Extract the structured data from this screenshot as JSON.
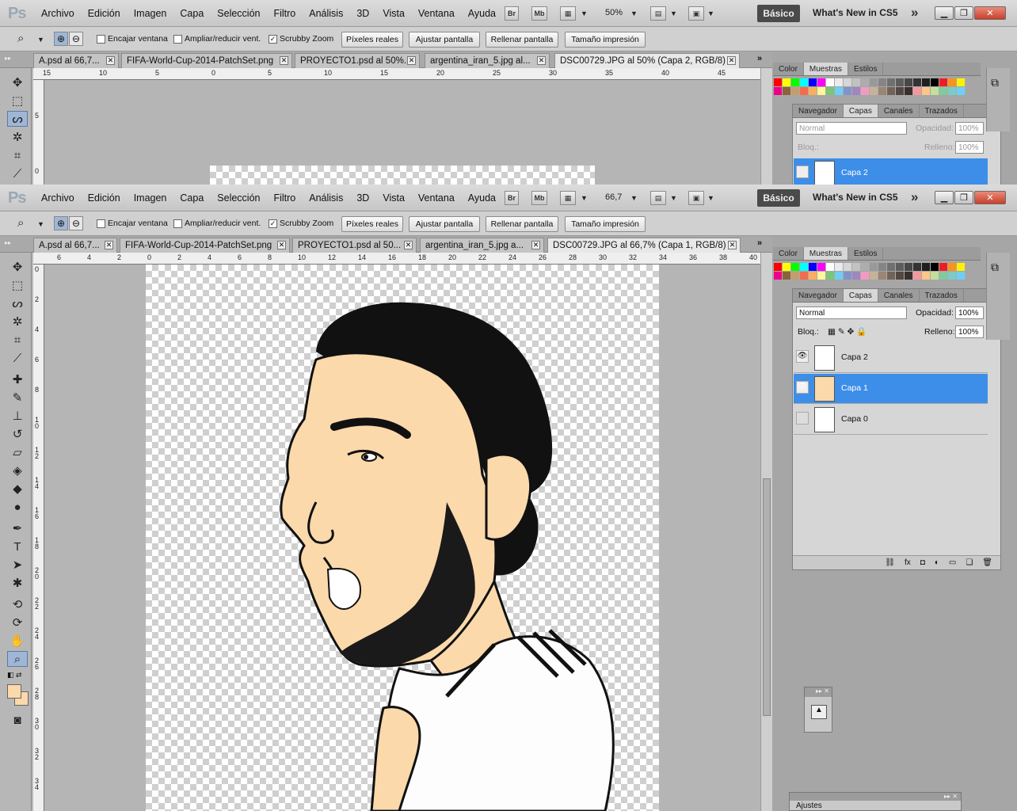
{
  "app": {
    "logo": "Ps"
  },
  "menu": [
    "Archivo",
    "Edición",
    "Imagen",
    "Capa",
    "Selección",
    "Filtro",
    "Análisis",
    "3D",
    "Vista",
    "Ventana",
    "Ayuda"
  ],
  "appbar": {
    "br": "Br",
    "mb": "Mb",
    "zoom_top": "50%",
    "zoom_bottom": "66,7",
    "workspace": "Básico",
    "whats_new": "What's New in CS5",
    "more": "»"
  },
  "options": {
    "checks": [
      {
        "label": "Encajar ventana",
        "checked": false
      },
      {
        "label": "Ampliar/reducir vent.",
        "checked": false
      },
      {
        "label": "Scrubby Zoom",
        "checked": true
      }
    ],
    "buttons": [
      "Píxeles reales",
      "Ajustar pantalla",
      "Rellenar pantalla",
      "Tamaño impresión"
    ]
  },
  "tabs_top": [
    "A.psd al 66,7...",
    "FIFA-World-Cup-2014-PatchSet.png",
    "PROYECTO1.psd al 50%...",
    "argentina_iran_5.jpg al...",
    "DSC00729.JPG al 50% (Capa 2, RGB/8) *"
  ],
  "tabs_bottom": [
    "A.psd al 66,7...",
    "FIFA-World-Cup-2014-PatchSet.png",
    "PROYECTO1.psd al 50...",
    "argentina_iran_5.jpg a...",
    "DSC00729.JPG al 66,7% (Capa 1, RGB/8) *"
  ],
  "ruler_top": [
    "15",
    "10",
    "5",
    "0",
    "5",
    "10",
    "15",
    "20",
    "25",
    "30",
    "35",
    "40",
    "45"
  ],
  "ruler_bottom": [
    "6",
    "4",
    "2",
    "0",
    "2",
    "4",
    "6",
    "8",
    "10",
    "12",
    "14",
    "16",
    "18",
    "20",
    "22",
    "24",
    "26",
    "28",
    "30",
    "32",
    "34",
    "36",
    "38",
    "40"
  ],
  "ruler_v_top": [
    "5",
    "0"
  ],
  "ruler_v_bottom": [
    "0",
    "2",
    "4",
    "6",
    "8",
    "1 0",
    "1 2",
    "1 4",
    "1 6",
    "1 8",
    "2 0",
    "2 2",
    "2 4",
    "2 6",
    "2 8",
    "3 0",
    "3 2",
    "3 4"
  ],
  "panels": {
    "color_tabs": [
      "Color",
      "Muestras",
      "Estilos"
    ],
    "layers_tabs": [
      "Navegador",
      "Capas",
      "Canales",
      "Trazados"
    ],
    "blend_mode": "Normal",
    "opacity_label": "Opacidad:",
    "opacity": "100%",
    "lock_label": "Bloq.:",
    "fill_label": "Relleno:",
    "fill": "100%",
    "layers_top": [
      {
        "name": "Capa 2",
        "visible": false,
        "selected": true
      }
    ],
    "layers": [
      {
        "name": "Capa 2",
        "visible": true,
        "selected": false
      },
      {
        "name": "Capa 1",
        "visible": true,
        "selected": true
      },
      {
        "name": "Capa 0",
        "visible": false,
        "selected": false
      }
    ],
    "ajustes": "Ajustes"
  },
  "colors": {
    "accent": "#3d8ee8",
    "skin": "#fbd9ab",
    "swatches": [
      "#ff0000",
      "#ffff00",
      "#00ff00",
      "#00ffff",
      "#0000ff",
      "#ff00ff",
      "#ffffff",
      "#ebebeb",
      "#d6d6d6",
      "#c2c2c2",
      "#adadad",
      "#999999",
      "#858585",
      "#707070",
      "#5c5c5c",
      "#474747",
      "#333333",
      "#1f1f1f",
      "#000000",
      "#ed1c24",
      "#f7941d",
      "#fff200",
      "#00a651",
      "#00aeef",
      "#2e3192"
    ],
    "swatches2": [
      "#ec008c",
      "#8c6239",
      "#c69c6d",
      "#f26c4f",
      "#fbaf5d",
      "#fff799",
      "#7cc576",
      "#6dcff6",
      "#8393ca",
      "#a186be",
      "#f49ac1",
      "#c7b299",
      "#998675",
      "#736357",
      "#534741",
      "#37302d",
      "#f5989d",
      "#fdc689",
      "#c4df9b",
      "#82ca9c",
      "#7accc8",
      "#6ecff6",
      "#7da7d9",
      "#a187be"
    ]
  }
}
